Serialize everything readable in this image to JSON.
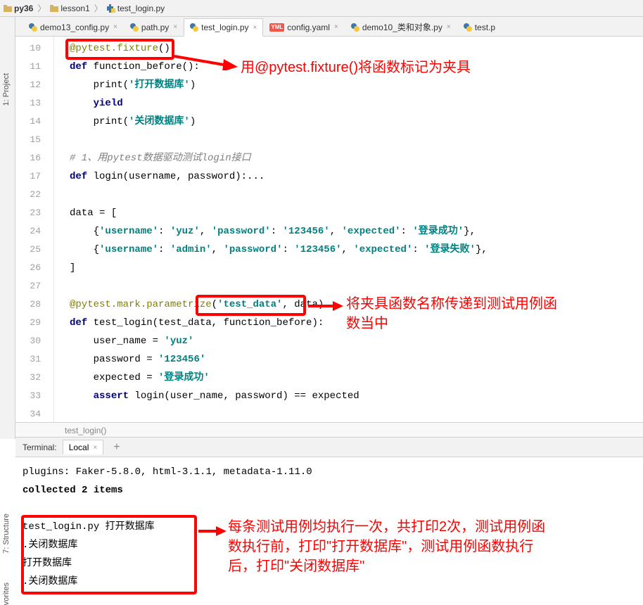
{
  "breadcrumb": {
    "root": "py36",
    "folder": "lesson1",
    "file": "test_login.py"
  },
  "tabs": [
    {
      "label": "demo13_config.py",
      "type": "py"
    },
    {
      "label": "path.py",
      "type": "py"
    },
    {
      "label": "test_login.py",
      "type": "py",
      "active": true
    },
    {
      "label": "config.yaml",
      "type": "yaml"
    },
    {
      "label": "demo10_类和对象.py",
      "type": "py"
    },
    {
      "label": "test.p",
      "type": "py",
      "cut": true
    }
  ],
  "line_numbers": [
    "10",
    "11",
    "12",
    "13",
    "14",
    "15",
    "16",
    "17",
    "22",
    "23",
    "24",
    "25",
    "26",
    "27",
    "28",
    "29",
    "30",
    "31",
    "32",
    "33",
    "34"
  ],
  "code": {
    "l10_dec": "@pytest.fixture",
    "l10_par": "()",
    "l11_kw": "def ",
    "l11_fn": "function_before():",
    "l12_fn": "print",
    "l12_par1": "(",
    "l12_str": "'打开数据库'",
    "l12_par2": ")",
    "l13_kw": "yield",
    "l14_fn": "print",
    "l14_par1": "(",
    "l14_str": "'关闭数据库'",
    "l14_par2": ")",
    "l16_com": "# 1、用pytest数据驱动测试login接口",
    "l17_kw": "def ",
    "l17_fn": "login(username, password):...",
    "l23_txt": "data = [",
    "l24_a": "    {",
    "l24_k1": "'username'",
    "l24_c1": ": ",
    "l24_v1": "'yuz'",
    "l24_c2": ", ",
    "l24_k2": "'password'",
    "l24_c3": ": ",
    "l24_v2": "'123456'",
    "l24_c4": ", ",
    "l24_k3": "'expected'",
    "l24_c5": ": ",
    "l24_v3": "'登录成功'",
    "l24_e": "},",
    "l25_a": "    {",
    "l25_k1": "'username'",
    "l25_c1": ": ",
    "l25_v1": "'admin'",
    "l25_c2": ", ",
    "l25_k2": "'password'",
    "l25_c3": ": ",
    "l25_v2": "'123456'",
    "l25_c4": ", ",
    "l25_k3": "'expected'",
    "l25_c5": ": ",
    "l25_v3": "'登录失败'",
    "l25_e": "},",
    "l26_txt": "]",
    "l28_dec": "@pytest.mark.parametrize",
    "l28_par1": "(",
    "l28_str": "'test_data'",
    "l28_par2": ", data)",
    "l29_kw": "def ",
    "l29_fn": "test_login(test_data, function_before):",
    "l30_txt": "    user_name = ",
    "l30_str": "'yuz'",
    "l31_txt": "    password = ",
    "l31_str": "'123456'",
    "l32_txt": "    expected = ",
    "l32_str": "'登录成功'",
    "l33_kw": "assert ",
    "l33_txt": "login(user_name, password) == expected"
  },
  "crumb": "test_login()",
  "sidebar": {
    "project": "1: Project",
    "structure": "7: Structure",
    "favorites": "vorites"
  },
  "terminal_header": {
    "label": "Terminal:",
    "tab": "Local"
  },
  "terminal": {
    "l1": "plugins: Faker-5.8.0, html-3.1.1, metadata-1.11.0",
    "l2": "collected 2 items",
    "l4": "test_login.py 打开数据库",
    "l5": ".关闭数据库",
    "l6": "打开数据库",
    "l7": ".关闭数据库"
  },
  "annotations": {
    "a1": "用@pytest.fixture()将函数标记为夹具",
    "a2a": "将夹具函数名称传递到测试用例函",
    "a2b": "数当中",
    "a3a": "每条测试用例均执行一次，共打印2次，测试用例函",
    "a3b": "数执行前，打印\"打开数据库\"，测试用例函数执行",
    "a3c": "后，打印\"关闭数据库\""
  }
}
